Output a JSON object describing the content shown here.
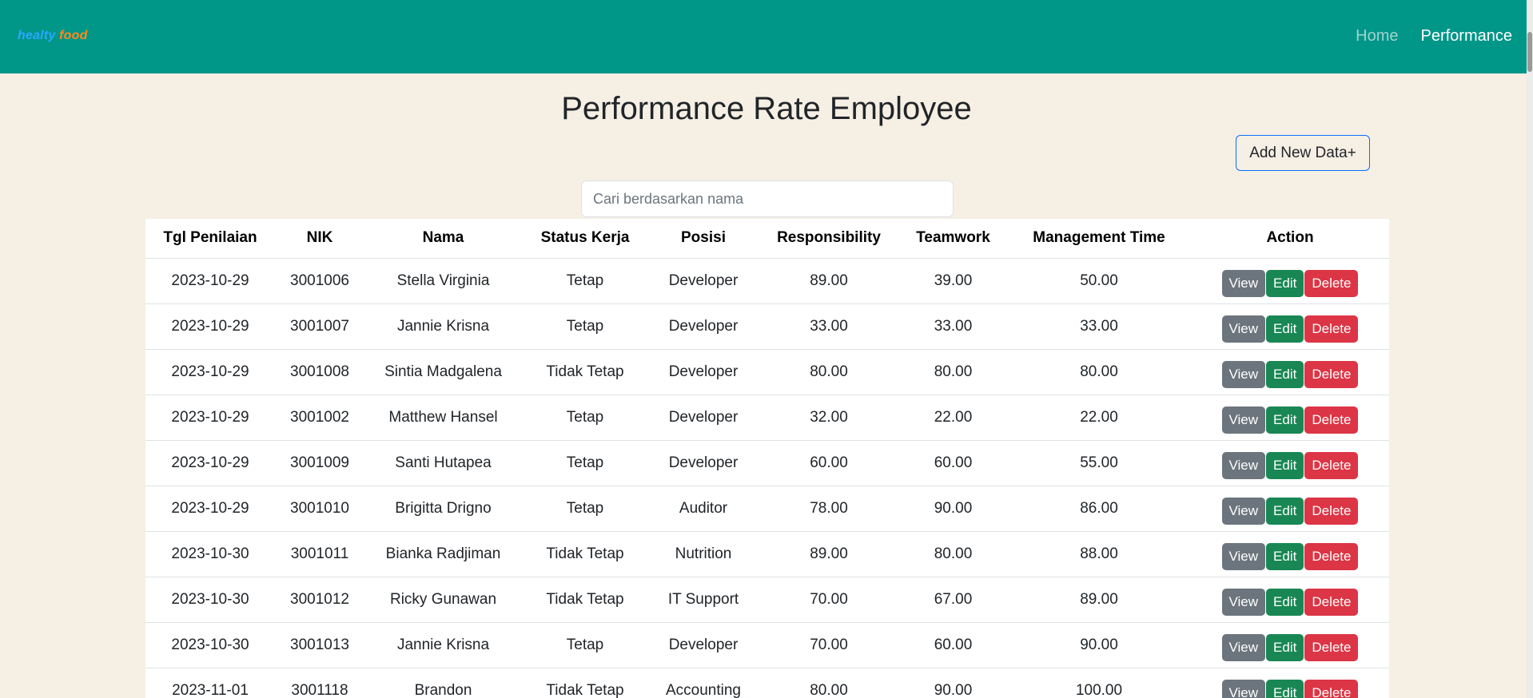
{
  "brand": {
    "part1": "healty",
    "part2": "food"
  },
  "nav": {
    "home": "Home",
    "performance": "Performance"
  },
  "page": {
    "title": "Performance Rate Employee",
    "add_button": "Add New Data+",
    "search_placeholder": "Cari berdasarkan nama"
  },
  "colors": {
    "navbar": "#009688",
    "background": "#f6efe4",
    "view": "#6c757d",
    "edit": "#198754",
    "delete": "#dc3545"
  },
  "table": {
    "headers": [
      "Tgl Penilaian",
      "NIK",
      "Nama",
      "Status Kerja",
      "Posisi",
      "Responsibility",
      "Teamwork",
      "Management Time",
      "Action"
    ],
    "action_labels": {
      "view": "View",
      "edit": "Edit",
      "delete": "Delete"
    },
    "rows": [
      [
        "2023-10-29",
        "3001006",
        "Stella Virginia",
        "Tetap",
        "Developer",
        "89.00",
        "39.00",
        "50.00"
      ],
      [
        "2023-10-29",
        "3001007",
        "Jannie Krisna",
        "Tetap",
        "Developer",
        "33.00",
        "33.00",
        "33.00"
      ],
      [
        "2023-10-29",
        "3001008",
        "Sintia Madgalena",
        "Tidak Tetap",
        "Developer",
        "80.00",
        "80.00",
        "80.00"
      ],
      [
        "2023-10-29",
        "3001002",
        "Matthew Hansel",
        "Tetap",
        "Developer",
        "32.00",
        "22.00",
        "22.00"
      ],
      [
        "2023-10-29",
        "3001009",
        "Santi Hutapea",
        "Tetap",
        "Developer",
        "60.00",
        "60.00",
        "55.00"
      ],
      [
        "2023-10-29",
        "3001010",
        "Brigitta Drigno",
        "Tetap",
        "Auditor",
        "78.00",
        "90.00",
        "86.00"
      ],
      [
        "2023-10-30",
        "3001011",
        "Bianka Radjiman",
        "Tidak Tetap",
        "Nutrition",
        "89.00",
        "80.00",
        "88.00"
      ],
      [
        "2023-10-30",
        "3001012",
        "Ricky Gunawan",
        "Tidak Tetap",
        "IT Support",
        "70.00",
        "67.00",
        "89.00"
      ],
      [
        "2023-10-30",
        "3001013",
        "Jannie Krisna",
        "Tetap",
        "Developer",
        "70.00",
        "60.00",
        "90.00"
      ],
      [
        "2023-11-01",
        "3001118",
        "Brandon",
        "Tidak Tetap",
        "Accounting",
        "80.00",
        "90.00",
        "100.00"
      ]
    ]
  }
}
